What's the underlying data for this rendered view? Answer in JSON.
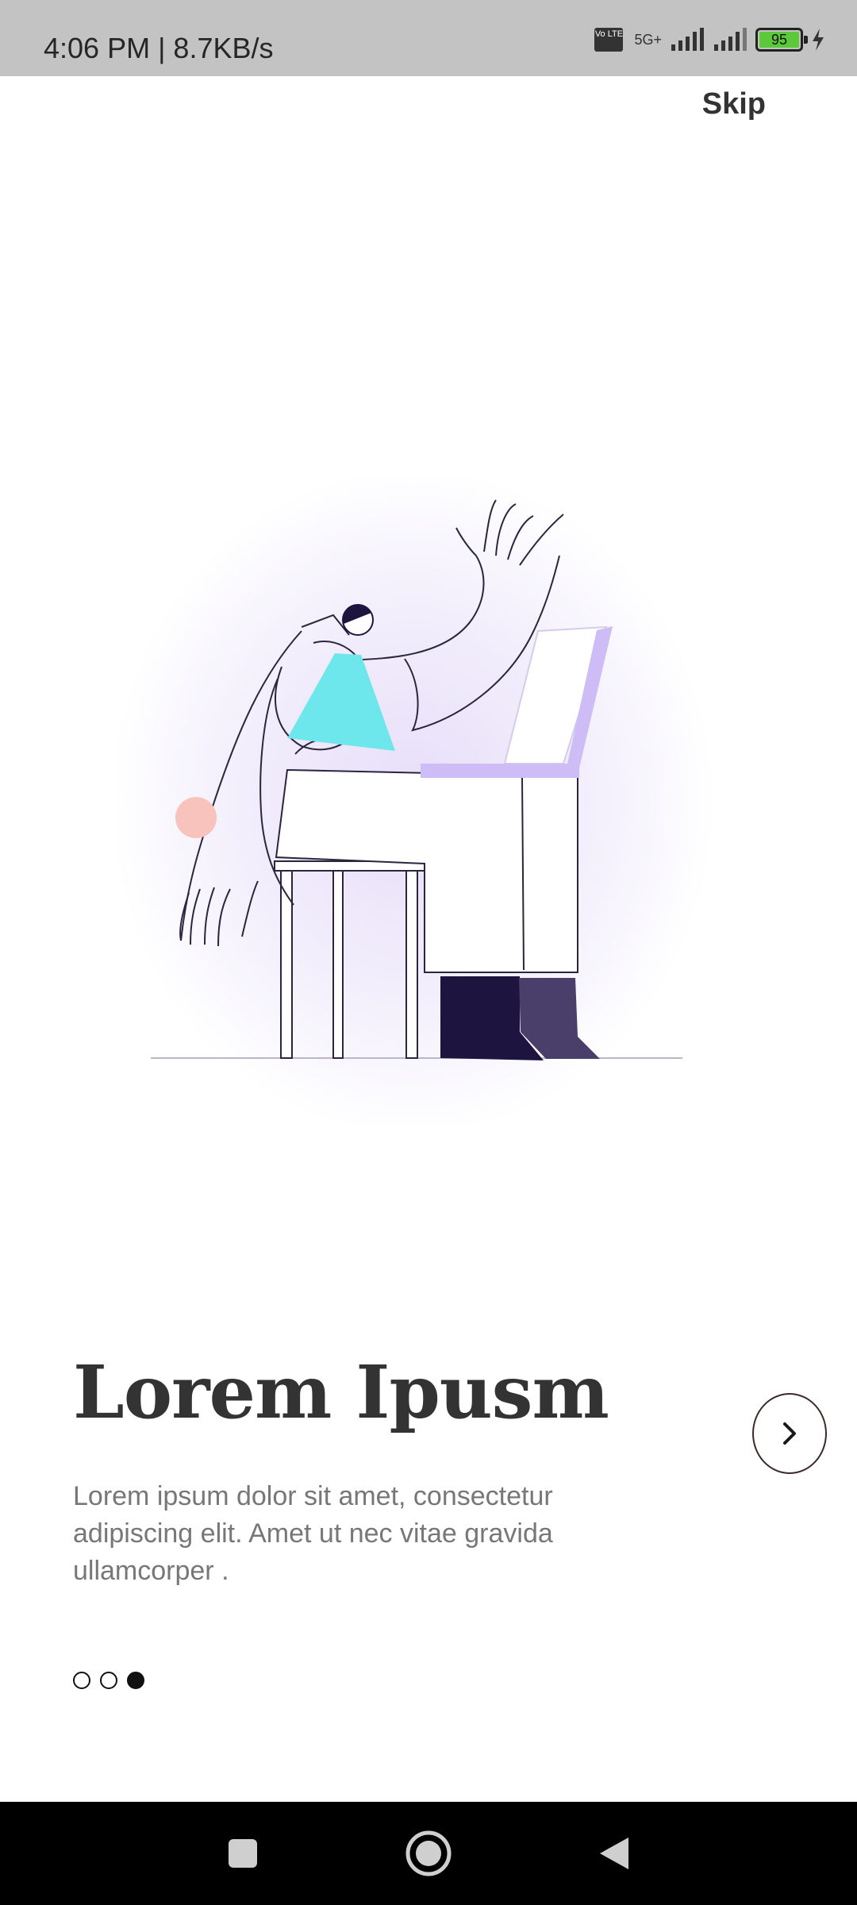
{
  "status_bar": {
    "time": "4:06 PM | 8.7KB/s",
    "network_label": "5G+",
    "volte_label": "Vo LTE",
    "battery_level": "95",
    "icons": [
      "volte-icon",
      "signal-icon",
      "signal-icon",
      "battery-icon",
      "charging-icon"
    ]
  },
  "header": {
    "skip_label": "Skip"
  },
  "onboarding": {
    "title": "Lorem Ipusm",
    "description": "Lorem ipsum dolor sit amet, consectetur adipiscing elit. Amet ut nec vitae gravida ullamcorper .",
    "next_icon": "chevron-right-icon",
    "page_index": 3,
    "page_count": 3
  },
  "illustration": {
    "subject": "waving-person-at-laptop-illustration"
  },
  "colors": {
    "status_bar_bg": "#c3c3c3",
    "title": "#333333",
    "body_text": "#777777",
    "accent_cyan": "#6ee7ec",
    "accent_lavender": "#cdbcf5",
    "accent_navy": "#1e1440",
    "accent_pink": "#f8c3bd",
    "nav_bar_bg": "#000000"
  },
  "nav_bar": {
    "icons": [
      "recents-square-icon",
      "home-circle-icon",
      "back-triangle-icon"
    ]
  }
}
